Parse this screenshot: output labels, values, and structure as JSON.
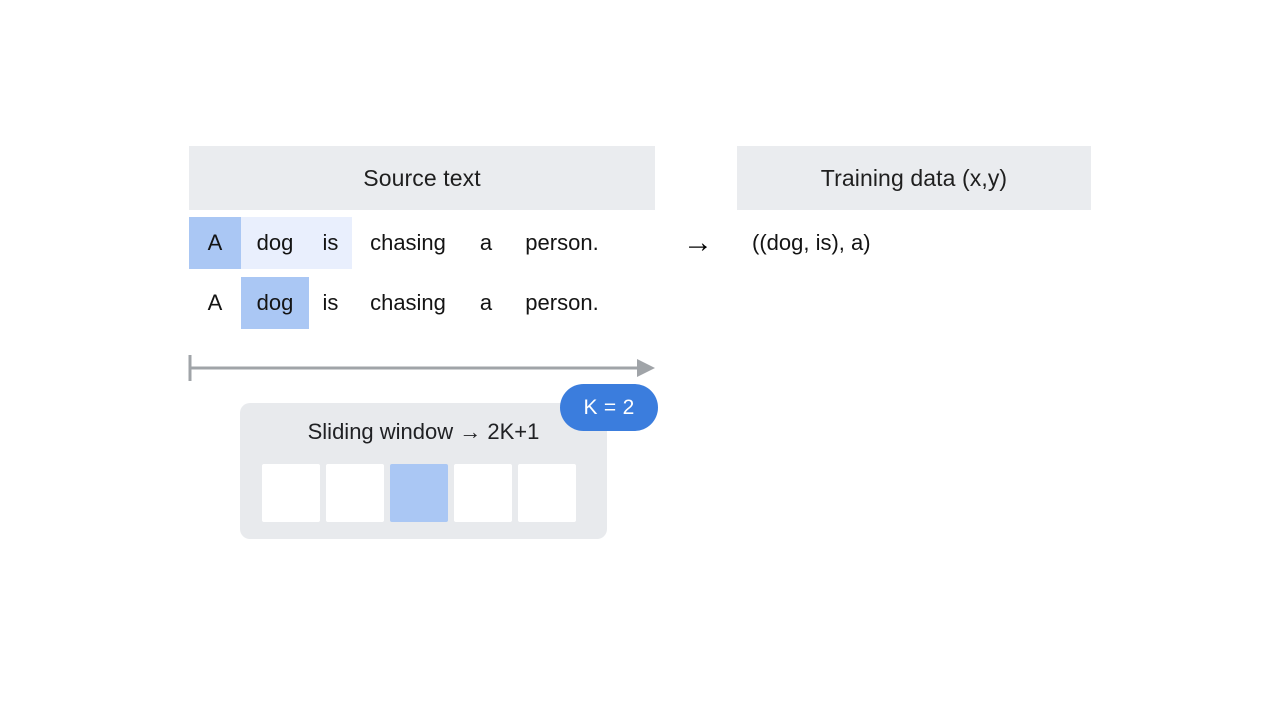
{
  "headers": {
    "source": "Source text",
    "training": "Training data (x,y)"
  },
  "rows": [
    {
      "name": "sentence-row-1",
      "tokens": [
        {
          "text": "A",
          "highlight": "strong",
          "width_class": "w-a"
        },
        {
          "text": "dog",
          "highlight": "soft",
          "width_class": "w-dog"
        },
        {
          "text": "is",
          "highlight": "soft",
          "width_class": "w-is"
        },
        {
          "text": "chasing",
          "highlight": "none",
          "width_class": "w-chasing"
        },
        {
          "text": "a",
          "highlight": "none",
          "width_class": "w-a2"
        },
        {
          "text": "person.",
          "highlight": "none",
          "width_class": "w-person"
        }
      ]
    },
    {
      "name": "sentence-row-2",
      "tokens": [
        {
          "text": "A",
          "highlight": "none",
          "width_class": "w-a"
        },
        {
          "text": "dog",
          "highlight": "strong",
          "width_class": "w-dog"
        },
        {
          "text": "is",
          "highlight": "none",
          "width_class": "w-is"
        },
        {
          "text": "chasing",
          "highlight": "none",
          "width_class": "w-chasing"
        },
        {
          "text": "a",
          "highlight": "none",
          "width_class": "w-a2"
        },
        {
          "text": "person.",
          "highlight": "none",
          "width_class": "w-person"
        }
      ]
    }
  ],
  "map_arrow": "→",
  "training_value": "((dog, is), a)",
  "window": {
    "title": "Sliding window → 2K+1",
    "cells": [
      {
        "active": false
      },
      {
        "active": false
      },
      {
        "active": true
      },
      {
        "active": false
      },
      {
        "active": false
      }
    ]
  },
  "badge": {
    "label": "K = 2"
  },
  "colors": {
    "header_bg": "#eaecef",
    "highlight_strong": "#aac7f4",
    "highlight_soft": "#e9effd",
    "panel_bg": "#e8eaed",
    "badge_bg": "#3b7ddd",
    "timeline": "#a0a4a8",
    "text": "#141414"
  }
}
